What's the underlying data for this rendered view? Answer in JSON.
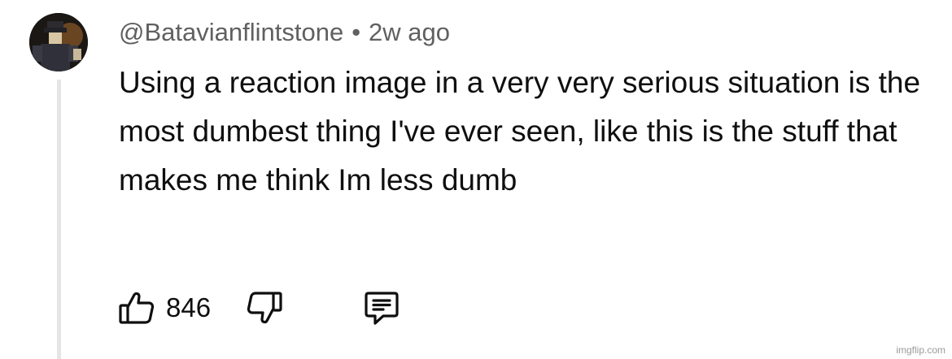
{
  "comment": {
    "username": "@Batavianflintstone",
    "separator": "•",
    "timestamp": "2w ago",
    "text": "Using a reaction image in a very very serious situation is the most dumbest thing I've ever seen, like this is the stuff that makes me think Im less dumb",
    "like_count": "846"
  },
  "icons": {
    "like": "thumbs-up-icon",
    "dislike": "thumbs-down-icon",
    "reply": "comment-reply-icon"
  },
  "watermark": "imgflip.com",
  "colors": {
    "text": "#0f0f0f",
    "meta": "#606060",
    "thread_line": "#e5e5e5",
    "background": "#ffffff"
  }
}
